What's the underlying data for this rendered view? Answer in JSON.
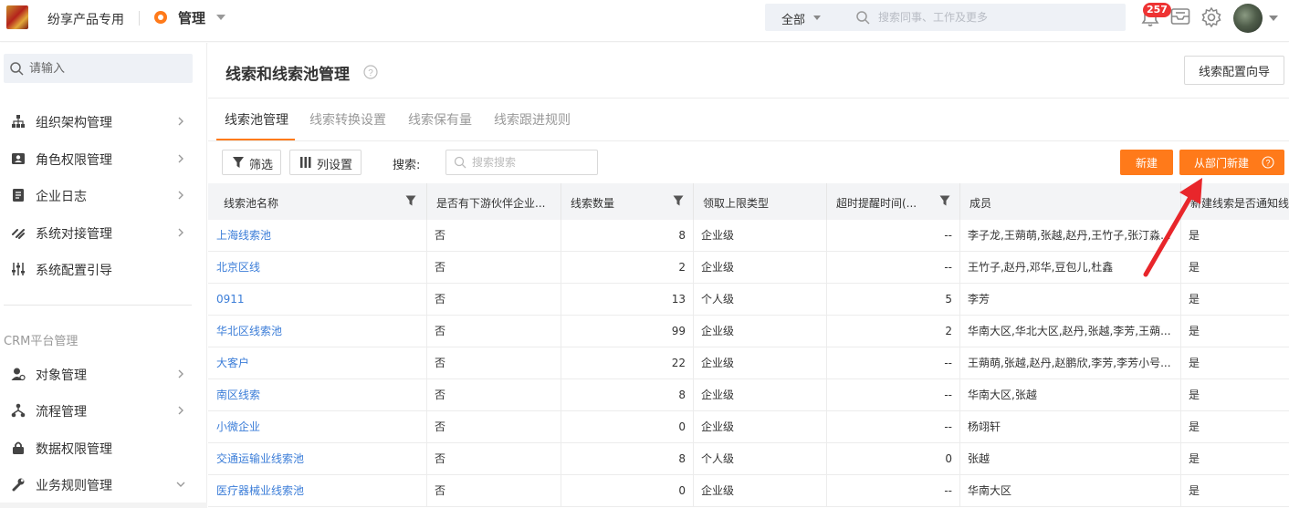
{
  "topbar": {
    "company": "纷享产品专用",
    "admin_label": "管理",
    "search_scope": "全部",
    "search_placeholder": "搜索同事、工作及更多",
    "notification_count": "257"
  },
  "sidebar": {
    "search_placeholder": "请输入",
    "items": [
      {
        "label": "组织架构管理",
        "icon": "org-chart-icon"
      },
      {
        "label": "角色权限管理",
        "icon": "role-card-icon"
      },
      {
        "label": "企业日志",
        "icon": "log-document-icon"
      },
      {
        "label": "系统对接管理",
        "icon": "link-icon"
      },
      {
        "label": "系统配置引导",
        "icon": "sliders-icon"
      }
    ],
    "group_label": "CRM平台管理",
    "crm_items": [
      {
        "label": "对象管理",
        "icon": "user-settings-icon"
      },
      {
        "label": "流程管理",
        "icon": "flow-icon"
      },
      {
        "label": "数据权限管理",
        "icon": "lock-icon"
      },
      {
        "label": "业务规则管理",
        "icon": "wrench-icon"
      }
    ]
  },
  "page": {
    "title": "线索和线索池管理",
    "wizard_button": "线索配置向导",
    "tabs": [
      "线索池管理",
      "线索转换设置",
      "线索保有量",
      "线索跟进规则"
    ],
    "active_tab": 0,
    "filter_button": "筛选",
    "columns_button": "列设置",
    "search_label": "搜索:",
    "search_placeholder": "搜索搜索",
    "new_button": "新建",
    "new_from_dept_button": "从部门新建"
  },
  "table": {
    "headers": [
      "线索池名称",
      "是否有下游伙伴企业...",
      "线索数量",
      "领取上限类型",
      "超时提醒时间(...",
      "成员",
      "新建线索是否通知线"
    ],
    "rows": [
      [
        "上海线索池",
        "否",
        "8",
        "企业级",
        "--",
        "李子龙,王蒴萌,张越,赵丹,王竹子,张汀淼...",
        "是"
      ],
      [
        "北京区线",
        "否",
        "2",
        "企业级",
        "--",
        "王竹子,赵丹,邓华,豆包儿,杜鑫",
        "是"
      ],
      [
        "0911",
        "否",
        "13",
        "个人级",
        "5",
        "李芳",
        "是"
      ],
      [
        "华北区线索池",
        "否",
        "99",
        "企业级",
        "2",
        "华南大区,华北大区,赵丹,张越,李芳,王蒴...",
        "是"
      ],
      [
        "大客户",
        "否",
        "22",
        "企业级",
        "--",
        "王蒴萌,张越,赵丹,赵鹏欣,李芳,李芳小号...",
        "是"
      ],
      [
        "南区线索",
        "否",
        "8",
        "企业级",
        "--",
        "华南大区,张越",
        "是"
      ],
      [
        "小微企业",
        "否",
        "0",
        "企业级",
        "--",
        "杨翊轩",
        "是"
      ],
      [
        "交通运输业线索池",
        "否",
        "8",
        "个人级",
        "0",
        "张越",
        "是"
      ],
      [
        "医疗器械业线索池",
        "否",
        "0",
        "企业级",
        "--",
        "华南大区",
        "是"
      ]
    ]
  },
  "colors": {
    "accent": "#ff7a1a",
    "link": "#3b7dd8",
    "annotation_arrow": "#e8262b"
  }
}
